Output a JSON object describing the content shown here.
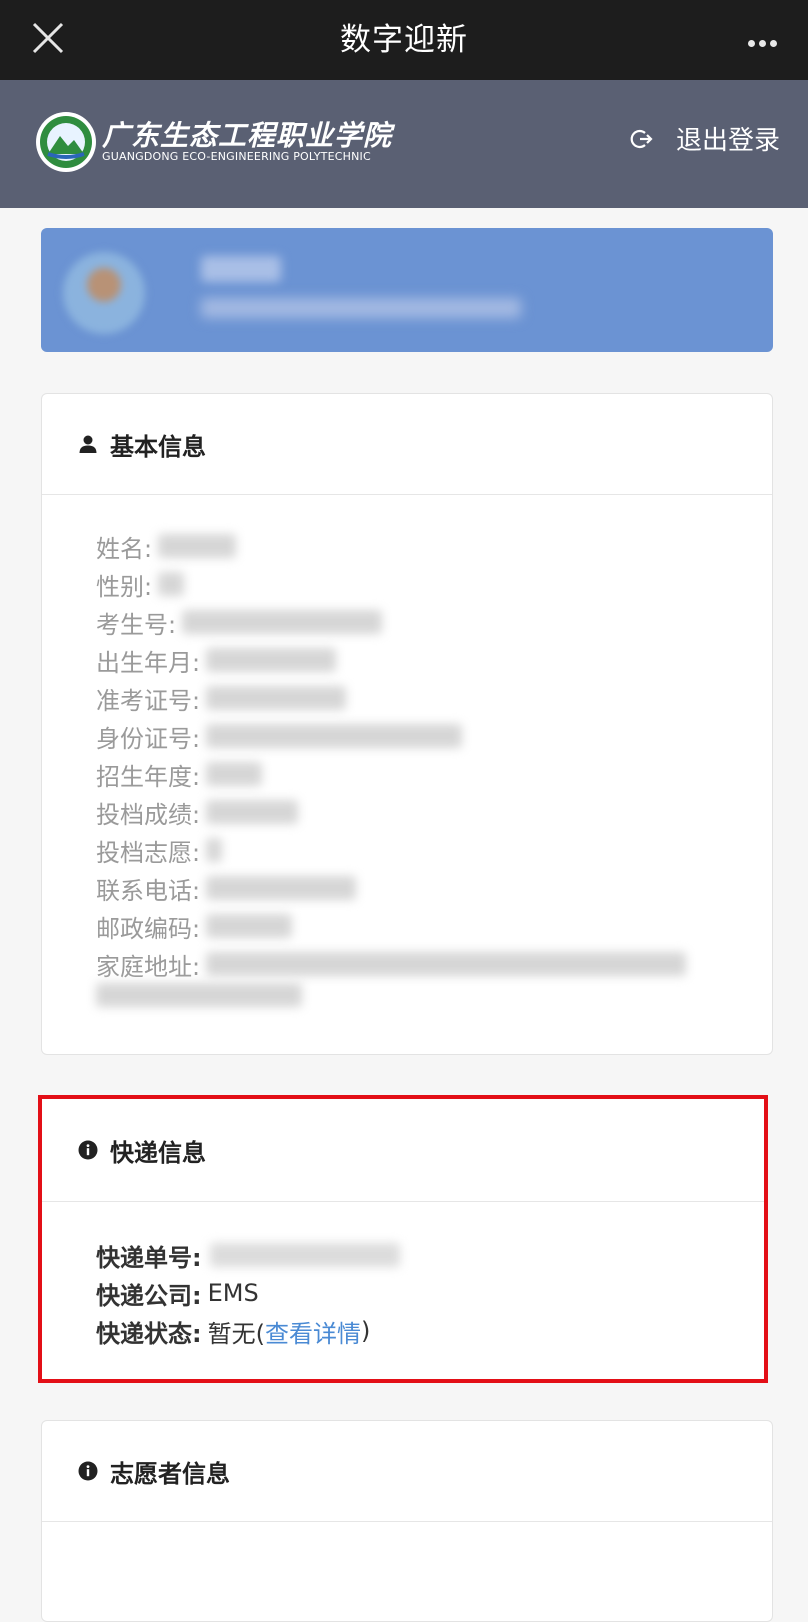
{
  "topbar": {
    "title": "数字迎新"
  },
  "header": {
    "school_name_cn": "广东生态工程职业学院",
    "school_name_en": "GUANGDONG ECO-ENGINEERING POLYTECHNIC",
    "logout_label": "退出登录"
  },
  "basic_info": {
    "title": "基本信息",
    "fields": [
      {
        "label": "姓名:"
      },
      {
        "label": "性别:"
      },
      {
        "label": "考生号:"
      },
      {
        "label": "出生年月:"
      },
      {
        "label": "准考证号:"
      },
      {
        "label": "身份证号:"
      },
      {
        "label": "招生年度:"
      },
      {
        "label": "投档成绩:"
      },
      {
        "label": "投档志愿:"
      },
      {
        "label": "联系电话:"
      },
      {
        "label": "邮政编码:"
      },
      {
        "label": "家庭地址:"
      }
    ]
  },
  "express_info": {
    "title": "快递信息",
    "tracking_label": "快递单号:",
    "company_label": "快递公司:",
    "company_value": "EMS",
    "status_label": "快递状态:",
    "status_value": "暂无(",
    "status_link": "查看详情",
    "status_close": ")"
  },
  "volunteer_info": {
    "title": "志愿者信息"
  },
  "colors": {
    "topbar": "#1d1d1d",
    "header": "#5a6073",
    "profile_card": "#6b93d3",
    "highlight_border": "#e30f17",
    "link": "#4a8ad4"
  }
}
